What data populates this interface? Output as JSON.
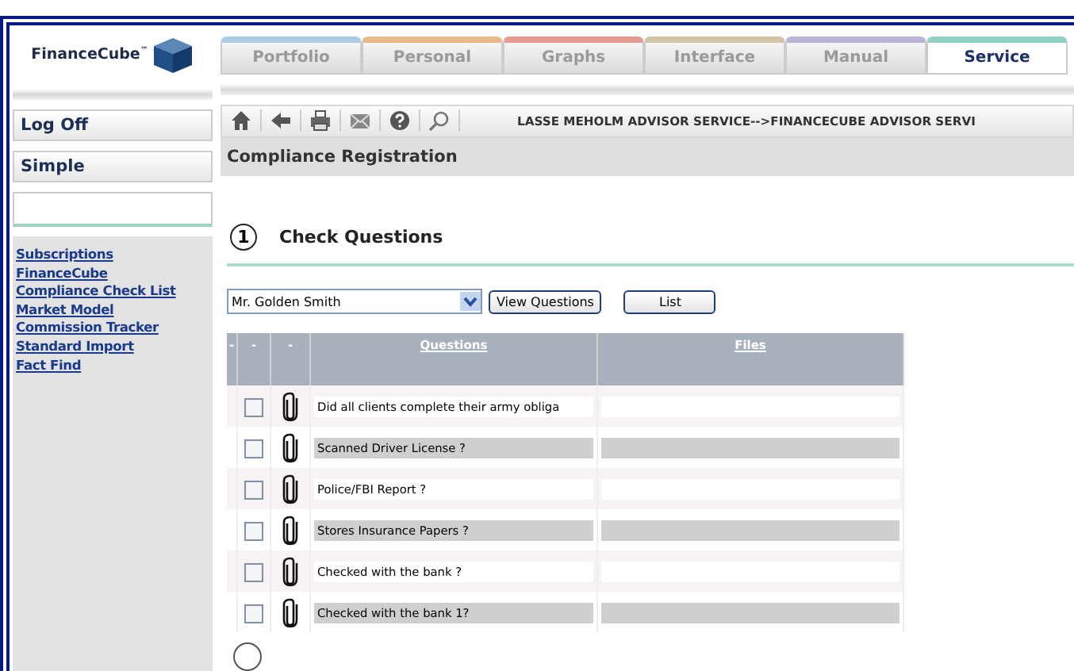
{
  "logo": {
    "text": "FinanceCube",
    "mark": "™"
  },
  "tabs": [
    {
      "label": "Portfolio",
      "color": "#a9cbe6",
      "selected": false
    },
    {
      "label": "Personal",
      "color": "#e8b98a",
      "selected": false
    },
    {
      "label": "Graphs",
      "color": "#e39a8f",
      "selected": false
    },
    {
      "label": "Interface",
      "color": "#d4c2a4",
      "selected": false
    },
    {
      "label": "Manual",
      "color": "#bcb3d8",
      "selected": false
    },
    {
      "label": "Service",
      "color": "#8fd0c2",
      "selected": true
    }
  ],
  "sidebar": {
    "buttons": [
      "Log Off",
      "Simple"
    ],
    "links": [
      "Subscriptions",
      "FinanceCube",
      "Compliance Check List",
      "Market Model",
      "Commission Tracker",
      "Standard Import",
      "Fact Find"
    ]
  },
  "toolbar": {
    "breadcrumb": "LASSE MEHOLM ADVISOR SERVICE-->FINANCECUBE ADVISOR SERVI"
  },
  "page_title": "Compliance Registration",
  "section": {
    "number": "1",
    "title": "Check Questions"
  },
  "client_select": {
    "value": "Mr. Golden Smith"
  },
  "buttons": [
    "View Questions",
    "List"
  ],
  "table": {
    "columns": [
      "-",
      "-",
      "-",
      "Questions",
      "Files"
    ],
    "rows": [
      {
        "question": "Did all clients complete their army obliga",
        "checked": false
      },
      {
        "question": "Scanned Driver License ?",
        "checked": false
      },
      {
        "question": "Police/FBI Report ?",
        "checked": false
      },
      {
        "question": "Stores Insurance Papers ?",
        "checked": false
      },
      {
        "question": "Checked with the bank ?",
        "checked": false
      },
      {
        "question": "Checked with the bank 1?",
        "checked": false
      }
    ]
  }
}
